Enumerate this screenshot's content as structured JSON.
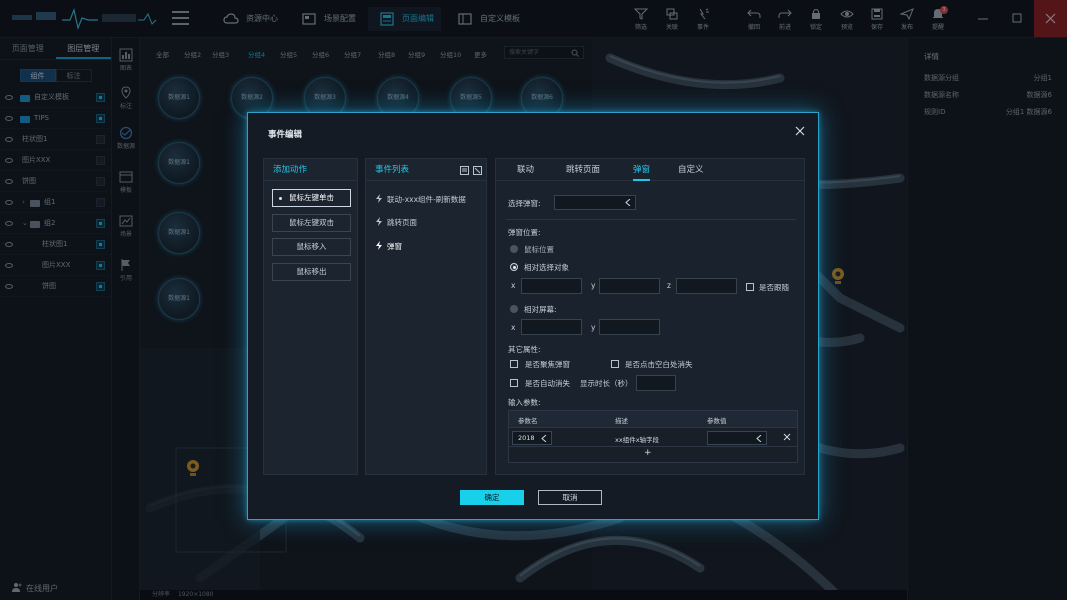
{
  "topbar": {
    "nav": [
      {
        "label": "资源中心",
        "icon": "cloud-icon"
      },
      {
        "label": "场景配置",
        "icon": "scene-icon"
      },
      {
        "label": "页面编辑",
        "icon": "page-edit-icon",
        "active": true
      },
      {
        "label": "自定义模板",
        "icon": "template-icon"
      }
    ],
    "tools": [
      {
        "label": "筛选",
        "icon": "filter-icon"
      },
      {
        "label": "关联",
        "icon": "link-icon"
      },
      {
        "label": "事件",
        "icon": "event-icon"
      },
      {
        "label": "撤回",
        "icon": "undo-icon"
      },
      {
        "label": "前进",
        "icon": "redo-icon"
      },
      {
        "label": "锁定",
        "icon": "lock-icon"
      },
      {
        "label": "预览",
        "icon": "preview-icon"
      },
      {
        "label": "保存",
        "icon": "save-icon"
      },
      {
        "label": "发布",
        "icon": "publish-icon"
      },
      {
        "label": "提醒",
        "icon": "bell-icon",
        "badge": "3"
      }
    ]
  },
  "left_panel": {
    "tabs": [
      "页面管理",
      "图层管理"
    ],
    "active_tab": "图层管理",
    "subtabs": [
      "组件",
      "标注"
    ],
    "active_subtab": "组件",
    "layers": [
      {
        "label": "自定义模板",
        "folder": true,
        "checked": true
      },
      {
        "label": "TIPS",
        "folder": true,
        "checked": true
      },
      {
        "label": "柱状图1",
        "folder": false,
        "checked": false
      },
      {
        "label": "图片XXX",
        "folder": false,
        "checked": false
      },
      {
        "label": "饼图",
        "folder": false,
        "checked": false
      },
      {
        "label": "组1",
        "folder": true,
        "checked": false
      },
      {
        "label": "组2",
        "folder": true,
        "checked": true
      },
      {
        "label": "柱状图1",
        "folder": false,
        "checked": true
      },
      {
        "label": "图片XXX",
        "folder": false,
        "checked": true
      },
      {
        "label": "饼图",
        "folder": false,
        "checked": true
      }
    ],
    "online_users": "在线用户"
  },
  "icon_column": [
    {
      "label": "图表",
      "icon": "chart-icon"
    },
    {
      "label": "标注",
      "icon": "marker-icon"
    },
    {
      "label": "数据源",
      "icon": "datasource-icon"
    },
    {
      "label": "模板",
      "icon": "template-icon"
    },
    {
      "label": "场景",
      "icon": "scene-icon"
    },
    {
      "label": "引用",
      "icon": "flag-icon"
    }
  ],
  "filter_bar": {
    "tabs": [
      "全部",
      "分组2",
      "分组3",
      "分组4",
      "分组5",
      "分组6",
      "分组7",
      "分组8",
      "分组9",
      "分组10",
      "更多"
    ],
    "active": "分组4",
    "search_placeholder": "搜索关键字"
  },
  "datasource_orbs": [
    "数据源1",
    "数据源2",
    "数据源3",
    "数据源4",
    "数据源5",
    "数据源6",
    "数据源1",
    "数据源1",
    "数据源1"
  ],
  "right_panel": {
    "title": "详情",
    "rows": [
      {
        "label": "数据源分组",
        "value": "分组1"
      },
      {
        "label": "数据源名称",
        "value": "数据源6"
      },
      {
        "label": "规则ID",
        "value": "分组1 数据源6"
      }
    ]
  },
  "bottom_bar": {
    "resolution_label": "分辨率",
    "resolution": "1920×1080"
  },
  "modal": {
    "title": "事件编辑",
    "add_action": {
      "title": "添加动作",
      "items": [
        "鼠标左键单击",
        "鼠标左键双击",
        "鼠标移入",
        "鼠标移出"
      ],
      "active": "鼠标左键单击"
    },
    "event_list": {
      "title": "事件列表",
      "items": [
        "联动-xxx组件-刷新数据",
        "跳转页面",
        "弹窗"
      ]
    },
    "tabs": [
      "联动",
      "跳转页面",
      "弹窗",
      "自定义"
    ],
    "active_tab": "弹窗",
    "popup": {
      "select_label": "选择弹窗:",
      "position_label": "弹窗位置:",
      "radios": [
        "鼠标位置",
        "相对选择对象",
        "相对屏幕:"
      ],
      "selected_radio": "相对选择对象",
      "axis_x": "x",
      "axis_y": "y",
      "axis_z": "z",
      "follow_label": "是否跟随",
      "other_label": "其它属性:",
      "focus_label": "是否聚焦弹窗",
      "click_blank_label": "是否点击空白处消失",
      "auto_hide_label": "是否自动消失",
      "duration_label": "显示时长（秒）",
      "params_label": "输入参数:",
      "param_headers": [
        "参数名",
        "描述",
        "参数值"
      ],
      "param_rows": [
        {
          "name": "2018",
          "desc": "xx组件x轴字段",
          "value": ""
        }
      ],
      "add_row": "+"
    },
    "ok_label": "确定",
    "cancel_label": "取消"
  }
}
